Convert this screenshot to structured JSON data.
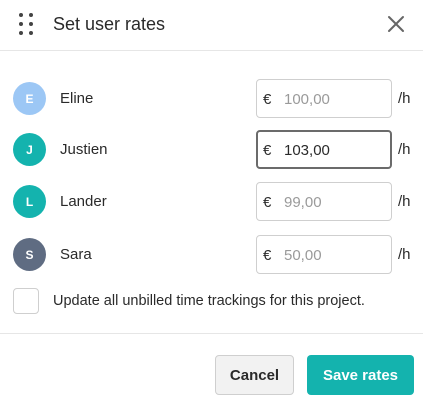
{
  "dialog": {
    "title": "Set user rates",
    "drag_icon": "drag-handle-icon",
    "close_icon": "close-icon"
  },
  "users": [
    {
      "initial": "E",
      "name": "Eline",
      "currency": "€",
      "rate": "100,00",
      "unit": "/h",
      "avatar_color": "#9cc7f5",
      "focused": false
    },
    {
      "initial": "J",
      "name": "Justien",
      "currency": "€",
      "rate": "103,00",
      "unit": "/h",
      "avatar_color": "#14b3ae",
      "focused": true
    },
    {
      "initial": "L",
      "name": "Lander",
      "currency": "€",
      "rate": "99,00",
      "unit": "/h",
      "avatar_color": "#14b3ae",
      "focused": false
    },
    {
      "initial": "S",
      "name": "Sara",
      "currency": "€",
      "rate": "50,00",
      "unit": "/h",
      "avatar_color": "#5f6c82",
      "focused": false
    }
  ],
  "update_option": {
    "label": "Update all unbilled time trackings for this project.",
    "checked": false
  },
  "footer": {
    "cancel_label": "Cancel",
    "save_label": "Save rates",
    "save_color": "#14b3ae"
  }
}
